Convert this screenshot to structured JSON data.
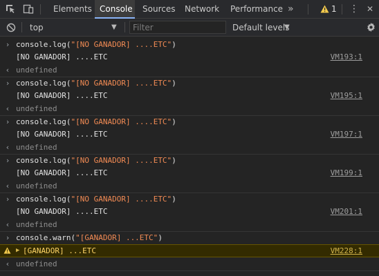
{
  "toolbar": {
    "tabs": [
      "Elements",
      "Console",
      "Sources",
      "Network",
      "Performance"
    ],
    "more_tabs": "»",
    "warning_count": "1",
    "kebab": "⋮",
    "close": "✕"
  },
  "filterbar": {
    "context": "top",
    "filter_placeholder": "Filter",
    "levels": "Default levels"
  },
  "colors": {
    "accent": "#8ab4f8",
    "string": "#f28b54",
    "warning_bg": "#332b00",
    "warning_text": "#ffd567"
  },
  "console": {
    "entries": [
      {
        "cmd_fn": "console.log(",
        "cmd_str": "\"[NO GANADOR] ....ETC\"",
        "cmd_close": ")",
        "output": "[NO GANADOR] ....ETC",
        "source": "VM193:1",
        "result": "undefined"
      },
      {
        "cmd_fn": "console.log(",
        "cmd_str": "\"[NO GANADOR] ....ETC\"",
        "cmd_close": ")",
        "output": "[NO GANADOR] ....ETC",
        "source": "VM195:1",
        "result": "undefined"
      },
      {
        "cmd_fn": "console.log(",
        "cmd_str": "\"[NO GANADOR] ....ETC\"",
        "cmd_close": ")",
        "output": "[NO GANADOR] ....ETC",
        "source": "VM197:1",
        "result": "undefined"
      },
      {
        "cmd_fn": "console.log(",
        "cmd_str": "\"[NO GANADOR] ....ETC\"",
        "cmd_close": ")",
        "output": "[NO GANADOR] ....ETC",
        "source": "VM199:1",
        "result": "undefined"
      },
      {
        "cmd_fn": "console.log(",
        "cmd_str": "\"[NO GANADOR] ....ETC\"",
        "cmd_close": ")",
        "output": "[NO GANADOR] ....ETC",
        "source": "VM201:1",
        "result": "undefined"
      }
    ],
    "warn_entry": {
      "cmd_fn": "console.warn(",
      "cmd_str": "\"[GANADOR] ...ETC\"",
      "cmd_close": ")",
      "output": "[GANADOR] ...ETC",
      "source": "VM228:1",
      "result": "undefined"
    }
  }
}
